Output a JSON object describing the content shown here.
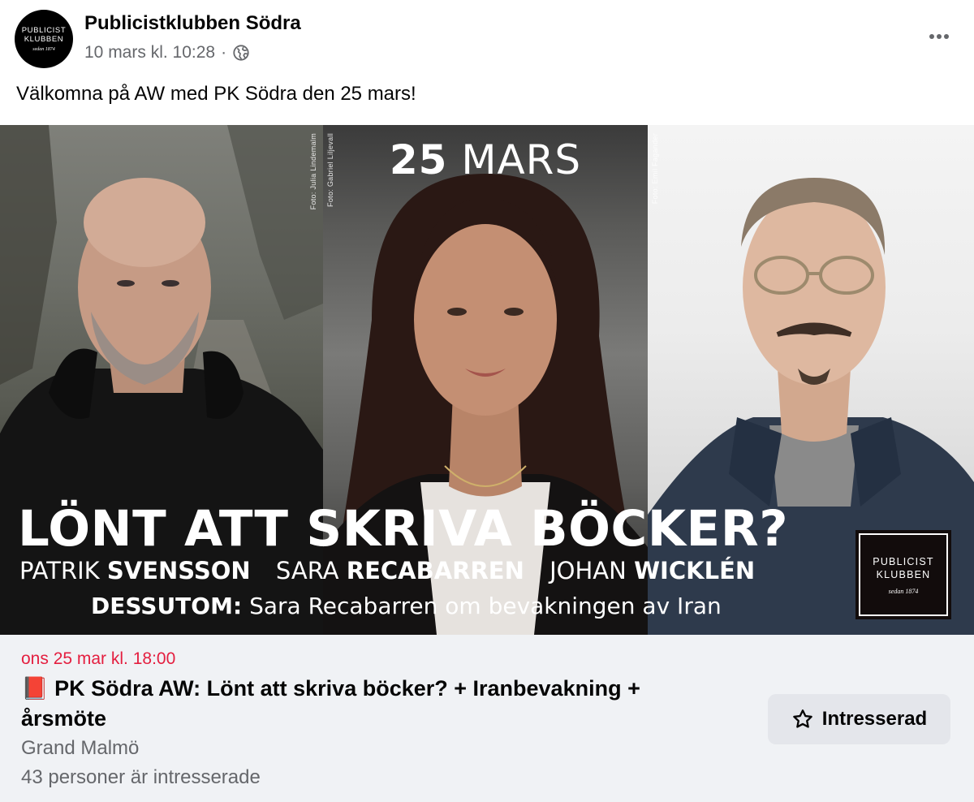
{
  "post": {
    "page_name": "Publicistklubben Södra",
    "timestamp": "10 mars kl. 10:28",
    "separator": "·",
    "audience_icon": "globe-icon",
    "more_icon": "more-options-icon",
    "text": "Välkomna på AW med PK Södra den 25 mars!"
  },
  "avatar": {
    "line1": "PUBLICIST",
    "line2": "KLUBBEN",
    "line3": "sedan 1874"
  },
  "image": {
    "date_bold": "25",
    "date_rest": "MARS",
    "credits": [
      "Foto: Julia Lindemalm",
      "Foto: Gabriel Liljevall",
      "Foto: Emil Fagander"
    ],
    "headline": "LÖNT ATT SKRIVA BÖCKER?",
    "speakers": [
      {
        "first": "PATRIK",
        "last": "SVENSSON"
      },
      {
        "first": "SARA",
        "last": "RECABARREN"
      },
      {
        "first": "JOHAN",
        "last": "WICKLÉN"
      }
    ],
    "also_label": "DESSUTOM:",
    "also_text": "Sara Recabarren om bevakningen av Iran",
    "logo": {
      "line1": "PUBLICIST",
      "line2": "KLUBBEN",
      "line3": "sedan 1874"
    }
  },
  "event": {
    "date": "ons 25 mar kl. 18:00",
    "emoji": "📕",
    "title": "PK Södra AW: Lönt att skriva böcker? + Iranbevakning + årsmöte",
    "venue": "Grand Malmö",
    "interested_count": "43 personer är intresserade",
    "button_label": "Intresserad",
    "button_icon": "star-icon"
  },
  "colors": {
    "event_date": "#e41e3f",
    "secondary_text": "#65676b",
    "event_bg": "#f0f2f5",
    "button_bg": "#e4e6eb"
  }
}
